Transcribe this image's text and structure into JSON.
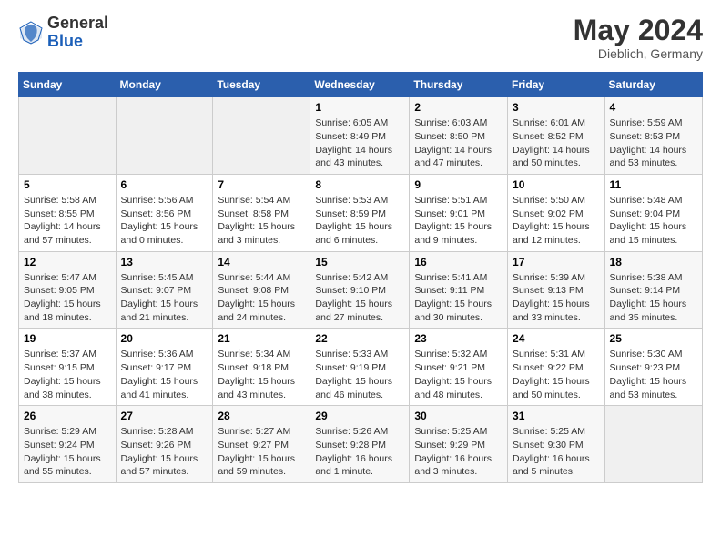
{
  "header": {
    "logo_general": "General",
    "logo_blue": "Blue",
    "month": "May 2024",
    "location": "Dieblich, Germany"
  },
  "weekdays": [
    "Sunday",
    "Monday",
    "Tuesday",
    "Wednesday",
    "Thursday",
    "Friday",
    "Saturday"
  ],
  "weeks": [
    [
      {
        "day": "",
        "info": ""
      },
      {
        "day": "",
        "info": ""
      },
      {
        "day": "",
        "info": ""
      },
      {
        "day": "1",
        "info": "Sunrise: 6:05 AM\nSunset: 8:49 PM\nDaylight: 14 hours\nand 43 minutes."
      },
      {
        "day": "2",
        "info": "Sunrise: 6:03 AM\nSunset: 8:50 PM\nDaylight: 14 hours\nand 47 minutes."
      },
      {
        "day": "3",
        "info": "Sunrise: 6:01 AM\nSunset: 8:52 PM\nDaylight: 14 hours\nand 50 minutes."
      },
      {
        "day": "4",
        "info": "Sunrise: 5:59 AM\nSunset: 8:53 PM\nDaylight: 14 hours\nand 53 minutes."
      }
    ],
    [
      {
        "day": "5",
        "info": "Sunrise: 5:58 AM\nSunset: 8:55 PM\nDaylight: 14 hours\nand 57 minutes."
      },
      {
        "day": "6",
        "info": "Sunrise: 5:56 AM\nSunset: 8:56 PM\nDaylight: 15 hours\nand 0 minutes."
      },
      {
        "day": "7",
        "info": "Sunrise: 5:54 AM\nSunset: 8:58 PM\nDaylight: 15 hours\nand 3 minutes."
      },
      {
        "day": "8",
        "info": "Sunrise: 5:53 AM\nSunset: 8:59 PM\nDaylight: 15 hours\nand 6 minutes."
      },
      {
        "day": "9",
        "info": "Sunrise: 5:51 AM\nSunset: 9:01 PM\nDaylight: 15 hours\nand 9 minutes."
      },
      {
        "day": "10",
        "info": "Sunrise: 5:50 AM\nSunset: 9:02 PM\nDaylight: 15 hours\nand 12 minutes."
      },
      {
        "day": "11",
        "info": "Sunrise: 5:48 AM\nSunset: 9:04 PM\nDaylight: 15 hours\nand 15 minutes."
      }
    ],
    [
      {
        "day": "12",
        "info": "Sunrise: 5:47 AM\nSunset: 9:05 PM\nDaylight: 15 hours\nand 18 minutes."
      },
      {
        "day": "13",
        "info": "Sunrise: 5:45 AM\nSunset: 9:07 PM\nDaylight: 15 hours\nand 21 minutes."
      },
      {
        "day": "14",
        "info": "Sunrise: 5:44 AM\nSunset: 9:08 PM\nDaylight: 15 hours\nand 24 minutes."
      },
      {
        "day": "15",
        "info": "Sunrise: 5:42 AM\nSunset: 9:10 PM\nDaylight: 15 hours\nand 27 minutes."
      },
      {
        "day": "16",
        "info": "Sunrise: 5:41 AM\nSunset: 9:11 PM\nDaylight: 15 hours\nand 30 minutes."
      },
      {
        "day": "17",
        "info": "Sunrise: 5:39 AM\nSunset: 9:13 PM\nDaylight: 15 hours\nand 33 minutes."
      },
      {
        "day": "18",
        "info": "Sunrise: 5:38 AM\nSunset: 9:14 PM\nDaylight: 15 hours\nand 35 minutes."
      }
    ],
    [
      {
        "day": "19",
        "info": "Sunrise: 5:37 AM\nSunset: 9:15 PM\nDaylight: 15 hours\nand 38 minutes."
      },
      {
        "day": "20",
        "info": "Sunrise: 5:36 AM\nSunset: 9:17 PM\nDaylight: 15 hours\nand 41 minutes."
      },
      {
        "day": "21",
        "info": "Sunrise: 5:34 AM\nSunset: 9:18 PM\nDaylight: 15 hours\nand 43 minutes."
      },
      {
        "day": "22",
        "info": "Sunrise: 5:33 AM\nSunset: 9:19 PM\nDaylight: 15 hours\nand 46 minutes."
      },
      {
        "day": "23",
        "info": "Sunrise: 5:32 AM\nSunset: 9:21 PM\nDaylight: 15 hours\nand 48 minutes."
      },
      {
        "day": "24",
        "info": "Sunrise: 5:31 AM\nSunset: 9:22 PM\nDaylight: 15 hours\nand 50 minutes."
      },
      {
        "day": "25",
        "info": "Sunrise: 5:30 AM\nSunset: 9:23 PM\nDaylight: 15 hours\nand 53 minutes."
      }
    ],
    [
      {
        "day": "26",
        "info": "Sunrise: 5:29 AM\nSunset: 9:24 PM\nDaylight: 15 hours\nand 55 minutes."
      },
      {
        "day": "27",
        "info": "Sunrise: 5:28 AM\nSunset: 9:26 PM\nDaylight: 15 hours\nand 57 minutes."
      },
      {
        "day": "28",
        "info": "Sunrise: 5:27 AM\nSunset: 9:27 PM\nDaylight: 15 hours\nand 59 minutes."
      },
      {
        "day": "29",
        "info": "Sunrise: 5:26 AM\nSunset: 9:28 PM\nDaylight: 16 hours\nand 1 minute."
      },
      {
        "day": "30",
        "info": "Sunrise: 5:25 AM\nSunset: 9:29 PM\nDaylight: 16 hours\nand 3 minutes."
      },
      {
        "day": "31",
        "info": "Sunrise: 5:25 AM\nSunset: 9:30 PM\nDaylight: 16 hours\nand 5 minutes."
      },
      {
        "day": "",
        "info": ""
      }
    ]
  ]
}
